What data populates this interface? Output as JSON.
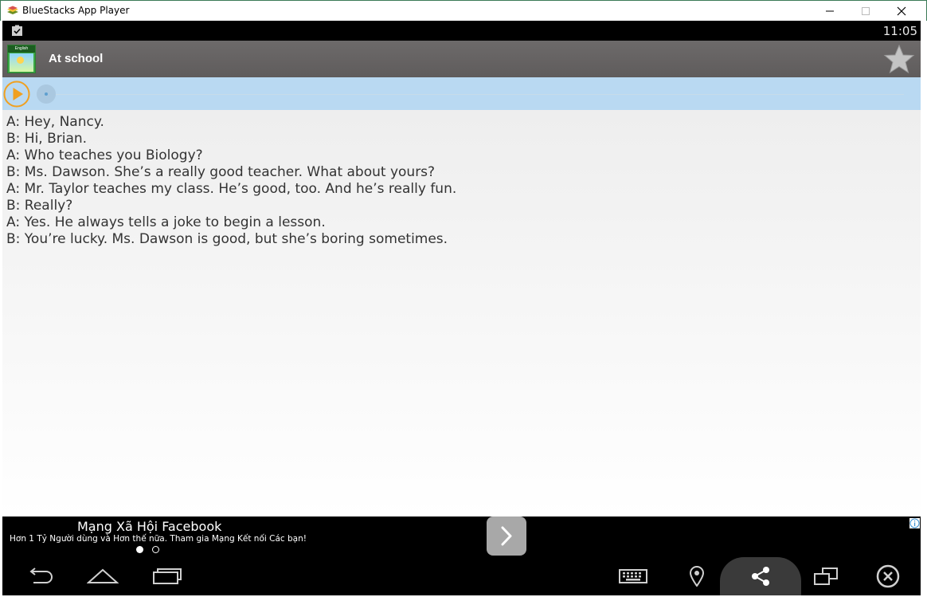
{
  "window": {
    "title": "BlueStacks App Player",
    "icons": {
      "logo": "bluestacks-logo-icon",
      "minimize": "minimize-icon",
      "maximize": "maximize-icon",
      "close": "close-icon"
    }
  },
  "statusbar": {
    "time": "11:05",
    "icon": "clipboard-check-icon"
  },
  "actionbar": {
    "title": "At school",
    "app_icon_label": "English",
    "favorite_icon": "star-icon"
  },
  "player": {
    "play_icon": "play-icon",
    "progress": 0
  },
  "dialogue": [
    "A: Hey, Nancy.",
    "B: Hi, Brian.",
    "A: Who teaches you Biology?",
    "B: Ms. Dawson. She’s a really good teacher. What about yours?",
    "A: Mr. Taylor teaches my class. He’s good, too. And he’s really fun.",
    "B: Really?",
    "A: Yes. He always tells a joke to begin a lesson.",
    "B: You’re lucky. Ms. Dawson is good, but she’s boring sometimes."
  ],
  "ad": {
    "title": "Mạng Xã Hội Facebook",
    "subtitle": "Hơn 1 Tỷ Người dùng và Hơn thế nữa. Tham gia Mạng Kết nối Các bạn!",
    "arrow_icon": "chevron-right-icon",
    "info_icon": "info-icon",
    "active_dot": 1,
    "dot_count": 2
  },
  "navbar": {
    "buttons": [
      "back-icon",
      "home-icon",
      "recent-apps-icon",
      "keyboard-icon",
      "location-icon",
      "share-icon",
      "multi-window-icon",
      "close-circle-icon"
    ]
  },
  "colors": {
    "window_border": "#3b7a57",
    "actionbar": "#666363",
    "player_bar": "#b9d9f2",
    "play_accent": "#f0a020",
    "text": "#333333"
  }
}
